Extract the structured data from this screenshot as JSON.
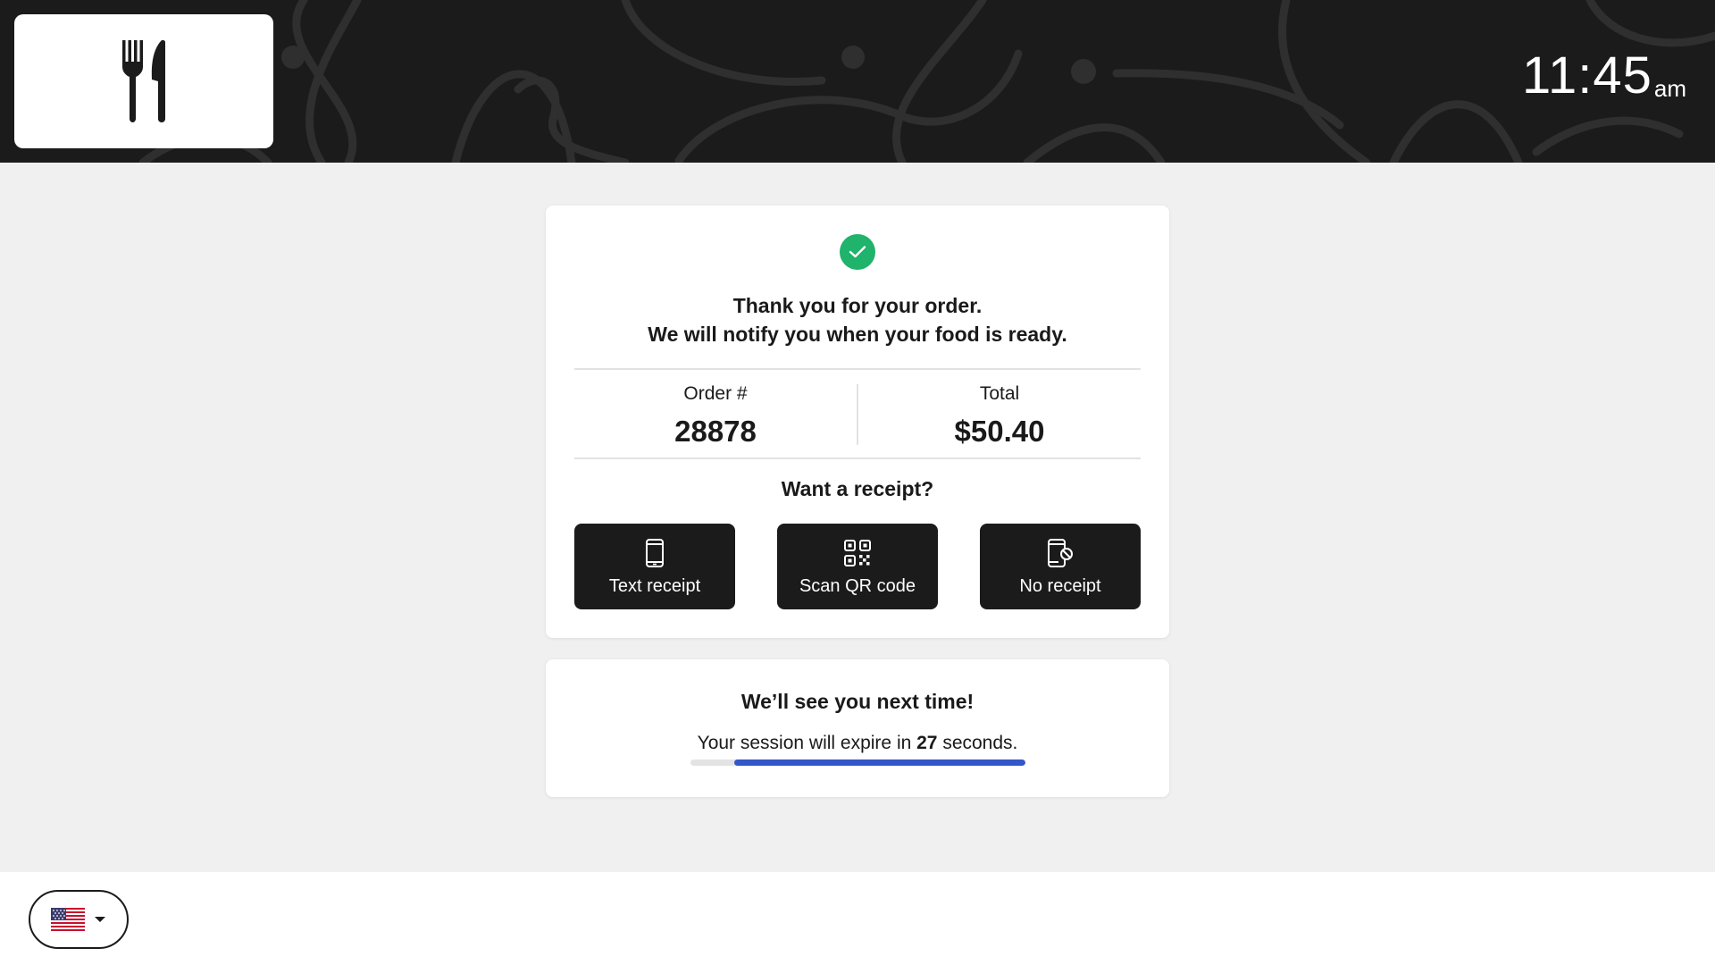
{
  "header": {
    "logo_icon": "fork-knife-icon",
    "clock": {
      "time": "11:45",
      "period": "am"
    }
  },
  "order": {
    "success_icon": "check-circle-icon",
    "success_color": "#1fb36b",
    "message_line1": "Thank you for your order.",
    "message_line2": "We will notify you when your food is ready.",
    "order_number_label": "Order #",
    "order_number": "28878",
    "total_label": "Total",
    "total": "$50.40"
  },
  "receipt": {
    "question": "Want a receipt?",
    "buttons": [
      {
        "label": "Text receipt",
        "icon": "phone-icon"
      },
      {
        "label": "Scan QR code",
        "icon": "qr-code-icon"
      },
      {
        "label": "No receipt",
        "icon": "phone-off-icon"
      }
    ]
  },
  "session": {
    "title": "We’ll see you next time!",
    "text_before": "Your session will expire in ",
    "seconds": "27",
    "text_after": " seconds.",
    "progress_fraction": 0.87,
    "progress_color": "#3357c9"
  },
  "footer": {
    "language_flag": "🇺🇸",
    "language_icon": "us-flag-icon",
    "dropdown_icon": "caret-down-icon"
  }
}
